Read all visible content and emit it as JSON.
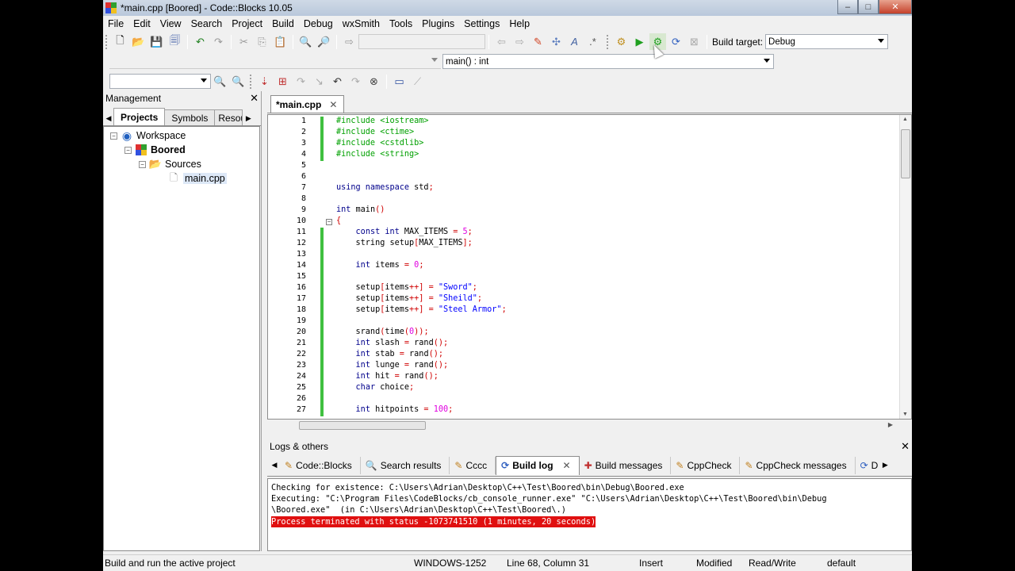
{
  "window": {
    "title": "*main.cpp [Boored] - Code::Blocks 10.05",
    "controls": {
      "minimize": "–",
      "maximize": "□",
      "close": "✕"
    }
  },
  "menu": [
    "File",
    "Edit",
    "View",
    "Search",
    "Project",
    "Build",
    "Debug",
    "wxSmith",
    "Tools",
    "Plugins",
    "Settings",
    "Help"
  ],
  "toolbar": {
    "build_target_label": "Build target:",
    "build_target_value": "Debug",
    "function_combo_value": "main() : int"
  },
  "management": {
    "title": "Management",
    "tabs": [
      "Projects",
      "Symbols",
      "Resou"
    ],
    "tree": {
      "workspace": "Workspace",
      "project": "Boored",
      "folder": "Sources",
      "file": "main.cpp"
    }
  },
  "editor": {
    "tab_label": "*main.cpp",
    "lines": [
      {
        "n": "1",
        "html": "<span class=\"pp\">#include &lt;iostream&gt;</span>"
      },
      {
        "n": "2",
        "html": "<span class=\"pp\">#include &lt;ctime&gt;</span>"
      },
      {
        "n": "3",
        "html": "<span class=\"pp\">#include &lt;cstdlib&gt;</span>"
      },
      {
        "n": "4",
        "html": "<span class=\"pp\">#include &lt;string&gt;</span>"
      },
      {
        "n": "5",
        "html": ""
      },
      {
        "n": "6",
        "html": ""
      },
      {
        "n": "7",
        "html": "<span class=\"kw\">using namespace</span> std<span class=\"op\">;</span>"
      },
      {
        "n": "8",
        "html": ""
      },
      {
        "n": "9",
        "html": "<span class=\"kw\">int</span> main<span class=\"op\">()</span>"
      },
      {
        "n": "10",
        "html": "<span class=\"op\">{</span>"
      },
      {
        "n": "11",
        "html": "    <span class=\"kw\">const int</span> MAX_ITEMS <span class=\"op\">=</span> <span class=\"num\">5</span><span class=\"op\">;</span>"
      },
      {
        "n": "12",
        "html": "    string setup<span class=\"op\">[</span>MAX_ITEMS<span class=\"op\">];</span>"
      },
      {
        "n": "13",
        "html": ""
      },
      {
        "n": "14",
        "html": "    <span class=\"kw\">int</span> items <span class=\"op\">=</span> <span class=\"num\">0</span><span class=\"op\">;</span>"
      },
      {
        "n": "15",
        "html": ""
      },
      {
        "n": "16",
        "html": "    setup<span class=\"op\">[</span>items<span class=\"op\">++]</span> <span class=\"op\">=</span> <span class=\"str\">\"Sword\"</span><span class=\"op\">;</span>"
      },
      {
        "n": "17",
        "html": "    setup<span class=\"op\">[</span>items<span class=\"op\">++]</span> <span class=\"op\">=</span> <span class=\"str\">\"Sheild\"</span><span class=\"op\">;</span>"
      },
      {
        "n": "18",
        "html": "    setup<span class=\"op\">[</span>items<span class=\"op\">++]</span> <span class=\"op\">=</span> <span class=\"str\">\"Steel Armor\"</span><span class=\"op\">;</span>"
      },
      {
        "n": "19",
        "html": ""
      },
      {
        "n": "20",
        "html": "    srand<span class=\"op\">(</span>time<span class=\"op\">(</span><span class=\"num\">0</span><span class=\"op\">));</span>"
      },
      {
        "n": "21",
        "html": "    <span class=\"kw\">int</span> slash <span class=\"op\">=</span> rand<span class=\"op\">();</span>"
      },
      {
        "n": "22",
        "html": "    <span class=\"kw\">int</span> stab <span class=\"op\">=</span> rand<span class=\"op\">();</span>"
      },
      {
        "n": "23",
        "html": "    <span class=\"kw\">int</span> lunge <span class=\"op\">=</span> rand<span class=\"op\">();</span>"
      },
      {
        "n": "24",
        "html": "    <span class=\"kw\">int</span> hit <span class=\"op\">=</span> rand<span class=\"op\">();</span>"
      },
      {
        "n": "25",
        "html": "    <span class=\"kw\">char</span> choice<span class=\"op\">;</span>"
      },
      {
        "n": "26",
        "html": ""
      },
      {
        "n": "27",
        "html": "    <span class=\"kw\">int</span> hitpoints <span class=\"op\">=</span> <span class=\"num\">100</span><span class=\"op\">;</span>"
      }
    ]
  },
  "logs": {
    "title": "Logs & others",
    "tabs": [
      "Code::Blocks",
      "Search results",
      "Cccc",
      "Build log",
      "Build messages",
      "CppCheck",
      "CppCheck messages",
      "D"
    ],
    "active_tab": "Build log",
    "lines": [
      "Checking for existence: C:\\Users\\Adrian\\Desktop\\C++\\Test\\Boored\\bin\\Debug\\Boored.exe",
      "Executing: \"C:\\Program Files\\CodeBlocks/cb_console_runner.exe\" \"C:\\Users\\Adrian\\Desktop\\C++\\Test\\Boored\\bin\\Debug",
      "\\Boored.exe\"  (in C:\\Users\\Adrian\\Desktop\\C++\\Test\\Boored\\.)"
    ],
    "error_line": "Process terminated with status -1073741510 (1 minutes, 20 seconds)"
  },
  "status": {
    "hint": "Build and run the active project",
    "encoding": "WINDOWS-1252",
    "position": "Line 68, Column 31",
    "mode": "Insert",
    "modified": "Modified",
    "access": "Read/Write",
    "lang": "default"
  },
  "colors": {
    "error_bg": "#e01010",
    "change_bar": "#40c040",
    "preprocessor": "#00a000"
  }
}
